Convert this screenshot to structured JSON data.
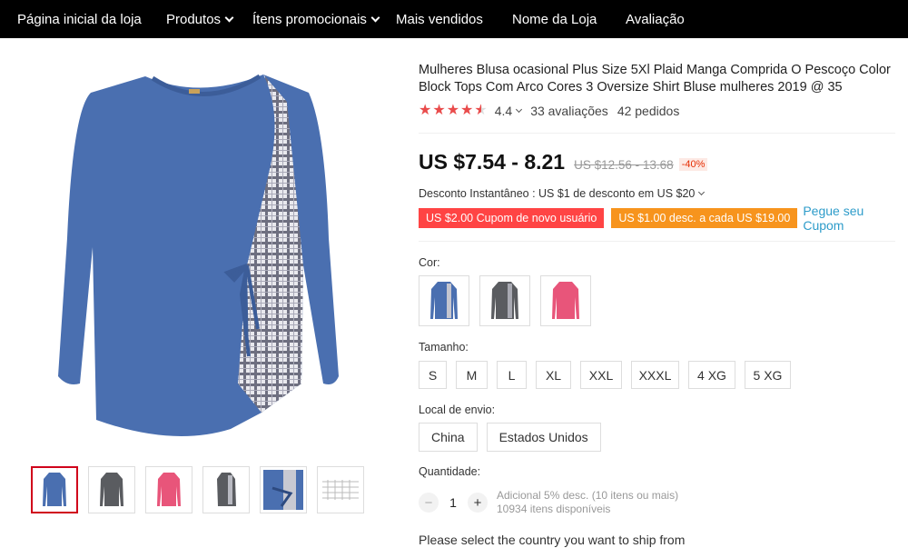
{
  "nav": {
    "items": [
      {
        "label": "Página inicial da loja",
        "dropdown": false
      },
      {
        "label": "Produtos",
        "dropdown": true
      },
      {
        "label": "Ítens promocionais",
        "dropdown": true
      },
      {
        "label": "Mais vendidos",
        "dropdown": false
      },
      {
        "label": "Nome da Loja",
        "dropdown": false
      },
      {
        "label": "Avaliação",
        "dropdown": false
      }
    ]
  },
  "product": {
    "title": "Mulheres Blusa ocasional Plus Size 5Xl Plaid Manga Comprida O Pescoço Color Block Tops Com Arco Cores 3 Oversize Shirt Bluse mulheres 2019 @ 35",
    "rating": "4.4",
    "stars": 4.5,
    "reviews": "33 avaliações",
    "orders": "42 pedidos",
    "price": "US $7.54 - 8.21",
    "old_price": "US $12.56 - 13.68",
    "discount": "-40%",
    "instant_discount": "Desconto Instantâneo : US $1 de desconto em US $20",
    "coupon_new_user": "US $2.00 Cupom de novo usuário",
    "coupon_every": "US $1.00 desc. a cada US $19.00",
    "coupon_link": "Pegue seu Cupom"
  },
  "options": {
    "color_label": "Cor:",
    "colors": [
      "blue",
      "gray",
      "pink"
    ],
    "size_label": "Tamanho:",
    "sizes": [
      "S",
      "M",
      "L",
      "XL",
      "XXL",
      "XXXL",
      "4 XG",
      "5 XG"
    ],
    "ship_label": "Local de envio:",
    "ship_from": [
      "China",
      "Estados Unidos"
    ],
    "qty_label": "Quantidade:",
    "qty_value": "1",
    "qty_minus": "−",
    "qty_plus": "+",
    "qty_bulk": "Adicional 5% desc. (10 itens ou mais)",
    "qty_available": "10934 itens disponíveis",
    "select_country": "Please select the country you want to ship from"
  },
  "colors": {
    "blue": "#4a6fb0",
    "gray": "#5a5c60",
    "pink": "#e8557a",
    "star": "#e94b4b",
    "coupon_red": "#ff4444",
    "coupon_orange": "#f7941d",
    "link": "#2e9cca"
  },
  "icons": {
    "chevron": "chevron-down-icon",
    "star": "star-icon",
    "minus": "minus-icon",
    "plus": "plus-icon"
  }
}
